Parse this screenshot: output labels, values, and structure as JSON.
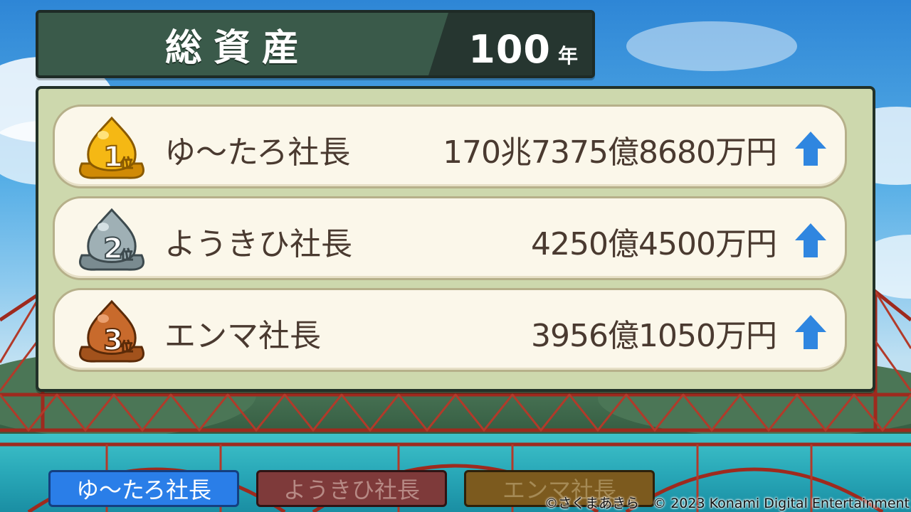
{
  "header": {
    "title": "総資産",
    "year_number": "100",
    "year_unit": "年"
  },
  "rankings": [
    {
      "rank": 1,
      "badge_label": "1",
      "badge_suffix": "位",
      "medal": "gold-medal-icon",
      "name": "ゆ〜たろ社長",
      "amount": "170兆7375億8680万円",
      "trend": "up-arrow-icon"
    },
    {
      "rank": 2,
      "badge_label": "2",
      "badge_suffix": "位",
      "medal": "silver-medal-icon",
      "name": "ようきひ社長",
      "amount": "4250億4500万円",
      "trend": "up-arrow-icon"
    },
    {
      "rank": 3,
      "badge_label": "3",
      "badge_suffix": "位",
      "medal": "bronze-medal-icon",
      "name": "エンマ社長",
      "amount": "3956億1050万円",
      "trend": "up-arrow-icon"
    }
  ],
  "player_tabs": [
    {
      "label": "ゆ〜たろ社長",
      "active": true,
      "color": "#2a7ee8"
    },
    {
      "label": "ようきひ社長",
      "active": false,
      "color": "#7e3a3a"
    },
    {
      "label": "エンマ社長",
      "active": false,
      "color": "#7c5a1e"
    }
  ],
  "colors": {
    "gold": "#f2b010",
    "silver": "#8fa0a6",
    "bronze": "#c2652a",
    "arrow": "#2f86e0",
    "panel": "#cdd8ad",
    "row": "#fbf7ea"
  },
  "copyright": "©さくまあきら　© 2023 Konami Digital Entertainment"
}
